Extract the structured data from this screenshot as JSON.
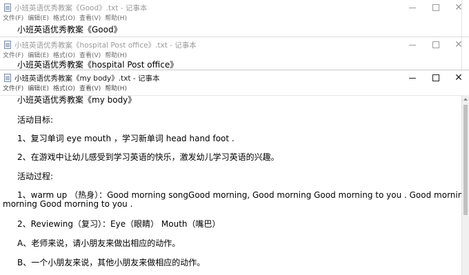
{
  "windows": [
    {
      "title": "小班英语优秀教案《Good》.txt - 记事本",
      "menu": [
        "文件(F)",
        "编辑(E)",
        "格式(O)",
        "查看(V)",
        "帮助(H)"
      ],
      "first_line": "小班英语优秀教案《Good》"
    },
    {
      "title": "小班英语优秀教案《hospital Post office》.txt - 记事本",
      "menu": [
        "文件(F)",
        "编辑(E)",
        "格式(O)",
        "查看(V)",
        "帮助(H)"
      ],
      "first_line": "小班英语优秀教案《hospital Post office》"
    },
    {
      "title": "小班英语优秀教案《my body》.txt - 记事本",
      "menu": [
        "文件(F)",
        "编辑(E)",
        "格式(O)",
        "查看(V)",
        "帮助(H)"
      ],
      "lines": [
        "小班英语优秀教案《my body》",
        "活动目标:",
        "1、复习单词 eye mouth ，学习新单词 head hand foot .",
        "2、在游戏中让幼儿感受到学习英语的快乐，激发幼儿学习英语的兴趣。",
        "活动过程:",
        "1、warm up （热身）：Good morning songGood morning, Good morning Good morning to you . Good morning Good",
        "morning Good morning to you .",
        "2、Reviewing（复习）：Eye（眼睛） Mouth（嘴巴）",
        "A、老师来说，请小朋友来做出相应的动作。",
        "B、一个小朋友来说，其他小朋友来做相应的动作。"
      ]
    }
  ],
  "controls": {
    "minimize": "—",
    "maximize": "☐",
    "close": "✕"
  }
}
